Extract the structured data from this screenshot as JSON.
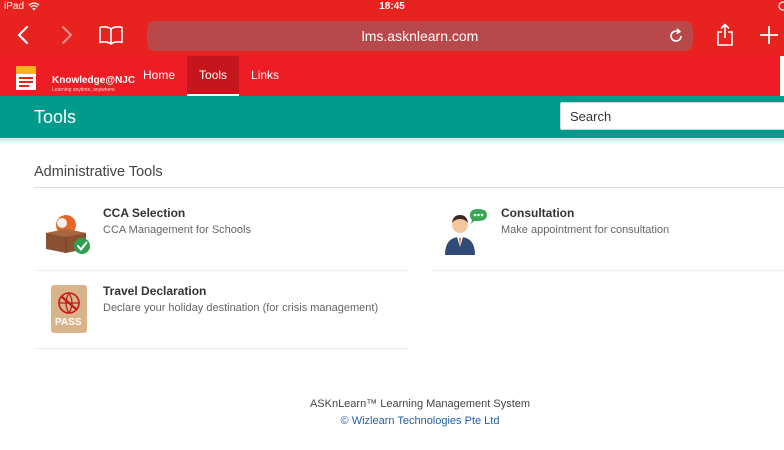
{
  "status_bar": {
    "carrier": "iPad",
    "time": "18:45"
  },
  "browser": {
    "url": "lms.asknlearn.com"
  },
  "site": {
    "logo_text": "Knowledge@NJC",
    "logo_tagline": "Learning anytime, anywhere",
    "nav": [
      {
        "label": "Home"
      },
      {
        "label": "Tools"
      },
      {
        "label": "Links"
      }
    ],
    "nav_active": "Tools"
  },
  "page": {
    "title": "Tools",
    "search_placeholder": "Search",
    "section_title": "Administrative Tools",
    "tools": [
      {
        "title": "CCA Selection",
        "description": "CCA Management for Schools",
        "icon": "cca-box-icon"
      },
      {
        "title": "Consultation",
        "description": "Make appointment for consultation",
        "icon": "consultation-person-icon"
      },
      {
        "title": "Travel Declaration",
        "description": "Declare your holiday destination (for crisis management)",
        "icon": "travel-pass-icon"
      }
    ]
  },
  "footer": {
    "line1": "ASKnLearn™ Learning Management System",
    "line2": "© Wizlearn Technologies Pte Ltd"
  },
  "colors": {
    "status_red": "#e8231f",
    "header_red": "#ee1c25",
    "teal": "#009b8d",
    "link_blue": "#1f5fa8"
  }
}
